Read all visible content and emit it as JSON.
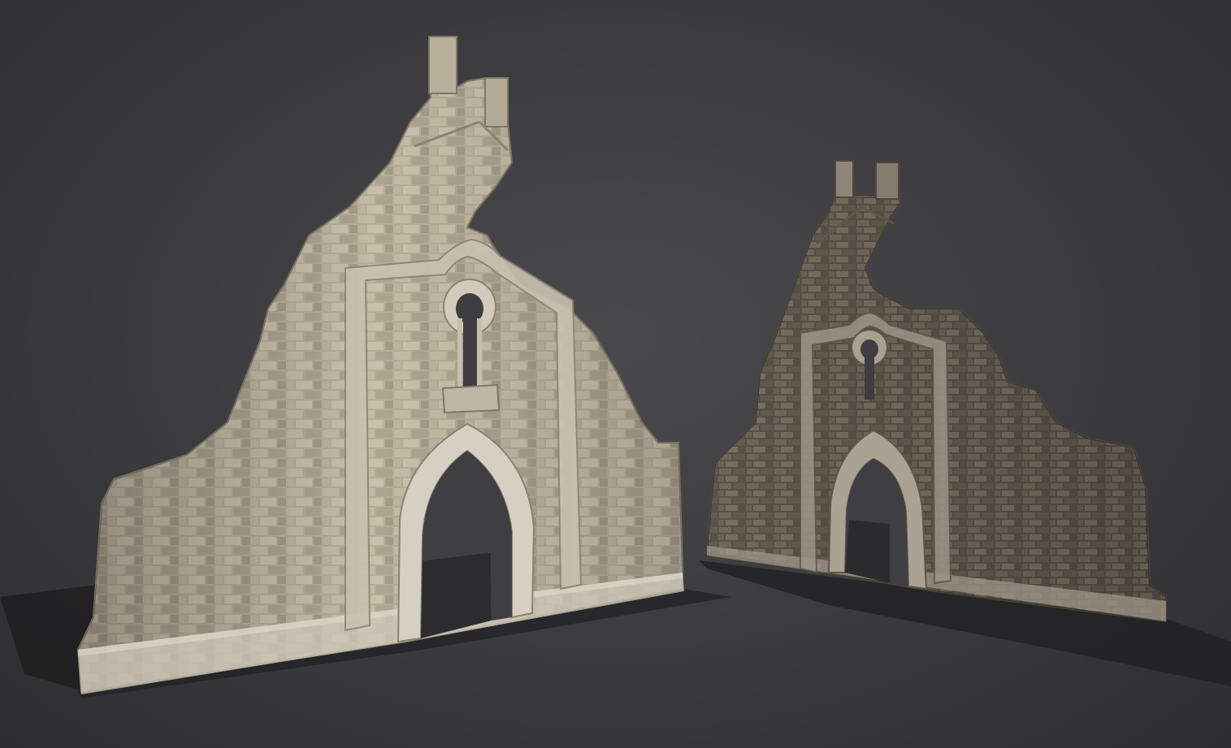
{
  "scene": {
    "background": "#3d3d3f",
    "objects": [
      {
        "name": "ruined-gothic-wall-clean",
        "stone_color": "#b9b09c",
        "mortar_color": "#8f877a",
        "trim_color": "#cfc8ba"
      },
      {
        "name": "ruined-gothic-wall-mossy",
        "stone_color": "#8e8576",
        "mortar_color": "#5e574c",
        "trim_color": "#a8a090"
      }
    ]
  }
}
